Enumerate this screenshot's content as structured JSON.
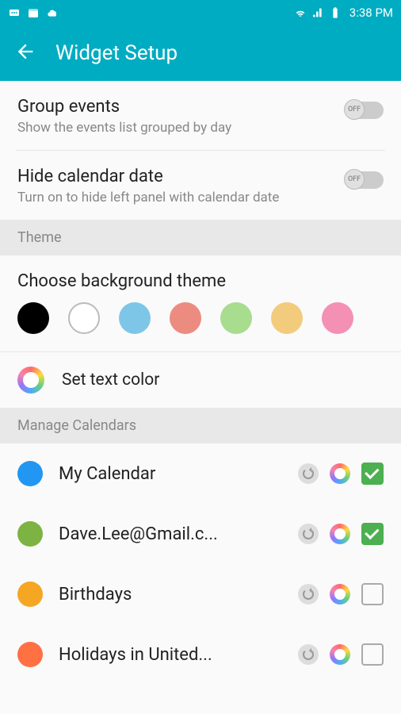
{
  "status": {
    "time": "3:38 PM"
  },
  "header": {
    "title": "Widget Setup"
  },
  "settings": {
    "groupEvents": {
      "title": "Group events",
      "subtitle": "Show the events list grouped by day",
      "toggleLabel": "OFF"
    },
    "hideDate": {
      "title": "Hide calendar date",
      "subtitle": "Turn on to hide left panel with calendar date",
      "toggleLabel": "OFF"
    }
  },
  "sections": {
    "theme": "Theme",
    "manageCalendars": "Manage Calendars"
  },
  "theme": {
    "chooseBg": "Choose background theme",
    "colors": [
      "#000000",
      "outline",
      "#7ec6e8",
      "#ec8b80",
      "#a8dc8f",
      "#f2cb7c",
      "#f490b4"
    ],
    "setTextColor": "Set text color"
  },
  "calendars": [
    {
      "name": "My Calendar",
      "color": "#2196f3",
      "checked": true
    },
    {
      "name": "Dave.Lee@Gmail.c...",
      "color": "#7cb342",
      "checked": true
    },
    {
      "name": "Birthdays",
      "color": "#f5a623",
      "checked": false
    },
    {
      "name": "Holidays in United...",
      "color": "#ff7043",
      "checked": false
    }
  ]
}
